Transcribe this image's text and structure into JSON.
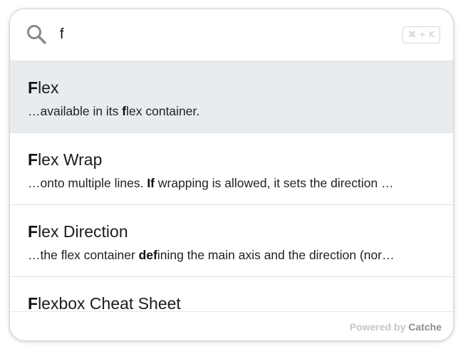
{
  "search": {
    "icon": "search-icon",
    "value": "f",
    "shortcut": "⌘ + K"
  },
  "results": [
    {
      "title_hl": "F",
      "title_rest": "lex",
      "excerpt_pre": "…available in its ",
      "excerpt_hl": "f",
      "excerpt_post": "lex container.",
      "active": true
    },
    {
      "title_hl": "F",
      "title_rest": "lex Wrap",
      "excerpt_pre": "…onto multiple lines. ",
      "excerpt_hl": "If",
      "excerpt_post": " wrapping is allowed, it sets the direction …",
      "active": false
    },
    {
      "title_hl": "F",
      "title_rest": "lex Direction",
      "excerpt_pre": "…the flex container ",
      "excerpt_hl": "def",
      "excerpt_post": "ining the main axis and the direction (nor…",
      "active": false
    },
    {
      "title_hl": "F",
      "title_rest": "lexbox Cheat Sheet",
      "excerpt_pre": "",
      "excerpt_hl": "",
      "excerpt_post": "",
      "active": false
    }
  ],
  "footer": {
    "powered_by": "Powered by",
    "brand": "Catche"
  }
}
